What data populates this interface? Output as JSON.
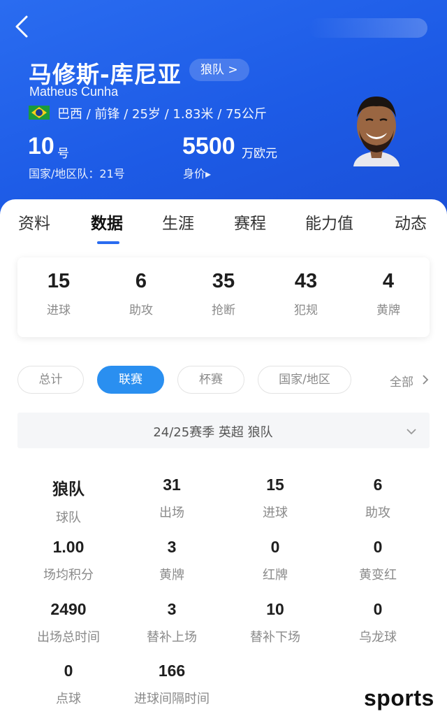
{
  "player": {
    "name_cn": "马修斯-库尼亚",
    "team_link": "狼队 >",
    "name_en": "Matheus Cunha",
    "meta": "巴西 / 前锋 / 25岁 / 1.83米 / 75公斤",
    "number": "10",
    "number_unit": "号",
    "national_number": "国家/地区队：21号",
    "value": "5500",
    "value_unit": "万欧元",
    "value_label": "身价▸",
    "flag_icon": "brazil-flag-icon"
  },
  "tabs": [
    "资料",
    "数据",
    "生涯",
    "赛程",
    "能力值",
    "动态"
  ],
  "active_tab": "数据",
  "summary": [
    {
      "value": "15",
      "label": "进球"
    },
    {
      "value": "6",
      "label": "助攻"
    },
    {
      "value": "35",
      "label": "抢断"
    },
    {
      "value": "43",
      "label": "犯规"
    },
    {
      "value": "4",
      "label": "黄牌"
    }
  ],
  "filters": [
    "总计",
    "联赛",
    "杯赛",
    "国家/地区"
  ],
  "active_filter": "联赛",
  "all_link": "全部",
  "season": "24/25赛季 英超 狼队",
  "stats": [
    {
      "value": "狼队",
      "label": "球队"
    },
    {
      "value": "31",
      "label": "出场"
    },
    {
      "value": "15",
      "label": "进球"
    },
    {
      "value": "6",
      "label": "助攻"
    },
    {
      "value": "1.00",
      "label": "场均积分"
    },
    {
      "value": "3",
      "label": "黄牌"
    },
    {
      "value": "0",
      "label": "红牌"
    },
    {
      "value": "0",
      "label": "黄变红"
    },
    {
      "value": "2490",
      "label": "出场总时间"
    },
    {
      "value": "3",
      "label": "替补上场"
    },
    {
      "value": "10",
      "label": "替补下场"
    },
    {
      "value": "0",
      "label": "乌龙球"
    },
    {
      "value": "0",
      "label": "点球"
    },
    {
      "value": "166",
      "label": "进球间隔时间"
    }
  ],
  "watermark": "sports",
  "colors": {
    "header": "#1d5be6",
    "accent": "#2a8ff0",
    "tab_indicator": "#2a6cf0"
  }
}
